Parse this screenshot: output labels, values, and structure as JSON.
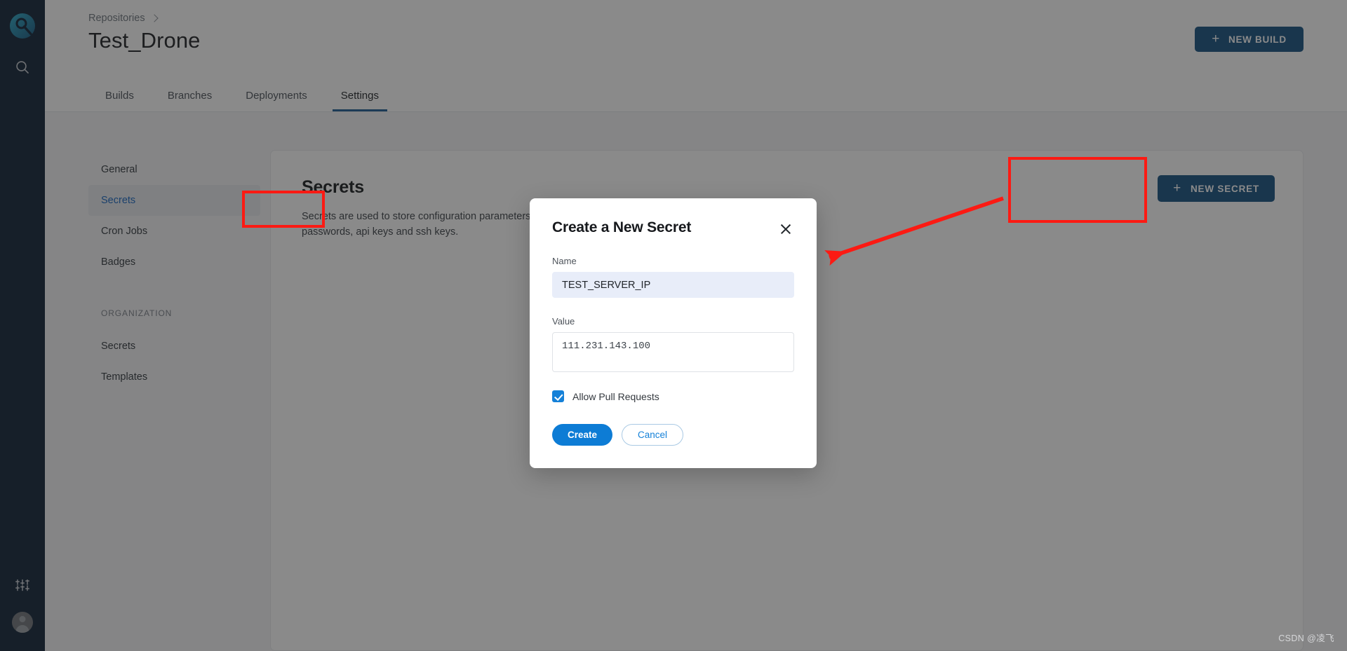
{
  "rail": {
    "logo_name": "drone-logo",
    "search_icon": "search-icon",
    "sliders_icon": "sliders-icon",
    "avatar": "user-avatar"
  },
  "header": {
    "breadcrumb_root": "Repositories",
    "breadcrumb_chevron_icon": "chevron-right-icon",
    "title": "Test_Drone",
    "new_build_button": "NEW BUILD",
    "plus_icon": "plus-icon",
    "tabs": [
      {
        "label": "Builds",
        "active": false
      },
      {
        "label": "Branches",
        "active": false
      },
      {
        "label": "Deployments",
        "active": false
      },
      {
        "label": "Settings",
        "active": true
      }
    ]
  },
  "settings_nav": {
    "items": [
      {
        "label": "General",
        "active": false
      },
      {
        "label": "Secrets",
        "active": true
      },
      {
        "label": "Cron Jobs",
        "active": false
      },
      {
        "label": "Badges",
        "active": false
      }
    ],
    "group_label": "ORGANIZATION",
    "group_items": [
      {
        "label": "Secrets",
        "active": false
      },
      {
        "label": "Templates",
        "active": false
      }
    ]
  },
  "card": {
    "title": "Secrets",
    "description": "Secrets are used to store configuration parameters, such as passwords, api keys and ssh keys.",
    "new_secret_button": "NEW SECRET",
    "plus_icon": "plus-icon"
  },
  "dialog": {
    "title": "Create a New Secret",
    "close_icon": "close-icon",
    "name_label": "Name",
    "name_value": "TEST_SERVER_IP",
    "name_placeholder": "",
    "value_label": "Value",
    "value_value": "111.231.143.100",
    "value_placeholder": "",
    "checkbox_label": "Allow Pull Requests",
    "checkbox_checked": true,
    "create_button": "Create",
    "cancel_button": "Cancel"
  },
  "annotations": {
    "highlight_secrets_nav": "red-box-around-secrets-nav-item",
    "highlight_new_secret": "red-box-around-new-secret-button",
    "arrow": "red-arrow-from-new-secret-to-dialog",
    "color": "#FC1A13"
  },
  "watermark": {
    "text": "CSDN @凌飞"
  },
  "colors": {
    "rail_bg": "#0E2136",
    "brand_dark_blue": "#145081",
    "accent_blue": "#1581D8",
    "create_blue": "#0D7CD5",
    "nav_active_text": "#1565C0",
    "input_focus_bg": "#E8EDF9",
    "content_bg": "#F4F5F7",
    "annotation_red": "#FC1A13"
  }
}
